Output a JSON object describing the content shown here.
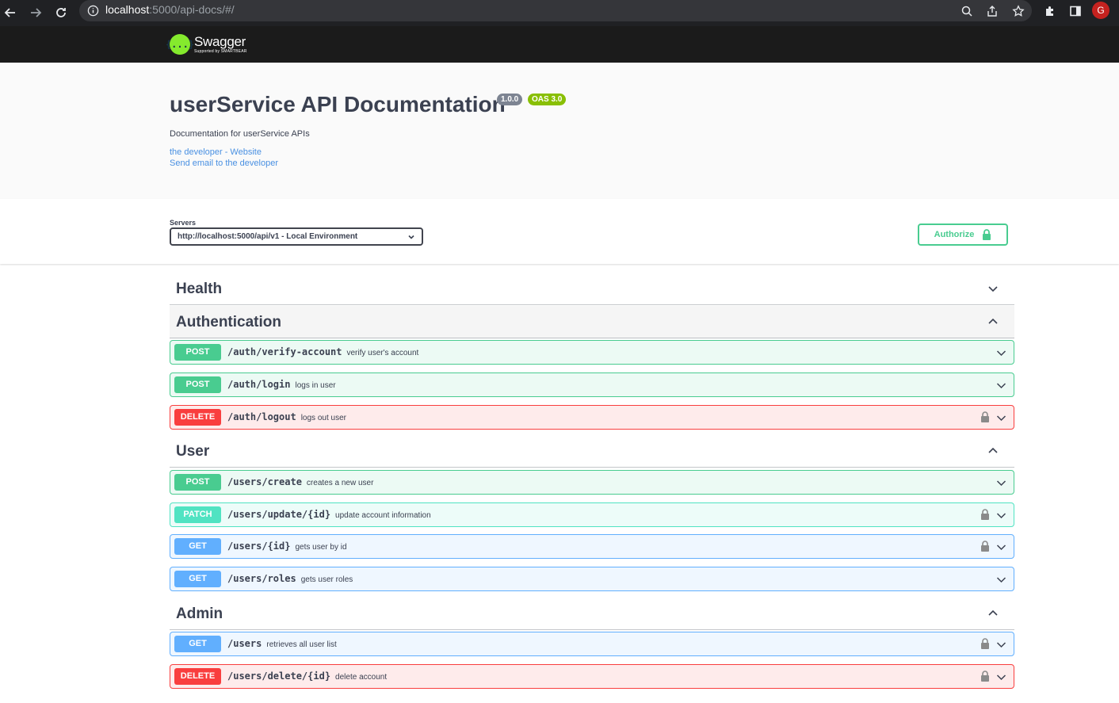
{
  "browser": {
    "url_host": "localhost",
    "url_path": ":5000/api-docs/#/",
    "profile_initial": "G"
  },
  "topbar": {
    "logo_title": "Swagger",
    "logo_subtitle": "Supported by SMARTBEAR",
    "logo_mark": "{...}"
  },
  "info": {
    "title": "userService API Documentation",
    "version": "1.0.0",
    "oas": "OAS 3.0",
    "description": "Documentation for userService APIs",
    "links": [
      "the developer - Website",
      "Send email to the developer"
    ]
  },
  "servers": {
    "label": "Servers",
    "selected": "http://localhost:5000/api/v1 - Local Environment"
  },
  "authorize_label": "Authorize",
  "tags": [
    {
      "name": "Health",
      "expanded": false
    },
    {
      "name": "Authentication",
      "expanded": true
    },
    {
      "name": "User",
      "expanded": true
    },
    {
      "name": "Admin",
      "expanded": true
    }
  ],
  "operations": [
    {
      "method": "POST",
      "path": "/auth/verify-account",
      "summary": "verify user's account",
      "locked": false
    },
    {
      "method": "POST",
      "path": "/auth/login",
      "summary": "logs in user",
      "locked": false
    },
    {
      "method": "DELETE",
      "path": "/auth/logout",
      "summary": "logs out user",
      "locked": true
    },
    {
      "method": "POST",
      "path": "/users/create",
      "summary": "creates a new user",
      "locked": false
    },
    {
      "method": "PATCH",
      "path": "/users/update/{id}",
      "summary": "update account information",
      "locked": true
    },
    {
      "method": "GET",
      "path": "/users/{id}",
      "summary": "gets user by id",
      "locked": true
    },
    {
      "method": "GET",
      "path": "/users/roles",
      "summary": "gets user roles",
      "locked": false
    },
    {
      "method": "GET",
      "path": "/users",
      "summary": "retrieves all user list",
      "locked": true
    },
    {
      "method": "DELETE",
      "path": "/users/delete/{id}",
      "summary": "delete account",
      "locked": true
    }
  ],
  "colors": {
    "post": "#49cc90",
    "delete": "#f93e3e",
    "patch": "#50e3c2",
    "get": "#61affe",
    "link": "#4990e2"
  }
}
